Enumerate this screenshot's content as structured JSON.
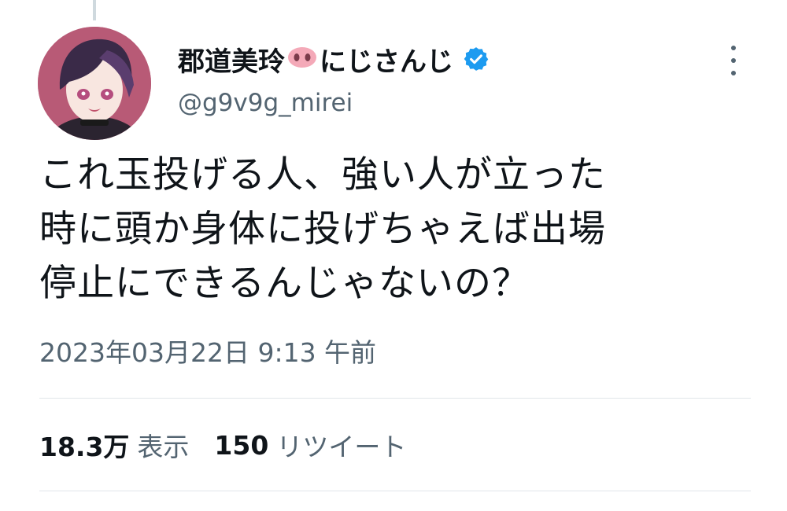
{
  "tweet": {
    "display_name": "郡道美玲",
    "name_emoji": "pig-nose-emoji",
    "name_suffix": "にじさんじ",
    "verified_icon": "verified-badge-icon",
    "handle": "@g9v9g_mirei",
    "more_icon": "more-options-icon",
    "text_lines": [
      "これ玉投げる人、強い人が立った",
      "時に頭か身体に投げちゃえば出場",
      "停止にできるんじゃないの？"
    ],
    "timestamp": "2023年03月22日 9:13 午前",
    "stats": {
      "views_count": "18.3万",
      "views_label": "表示",
      "retweets_count": "150",
      "retweets_label": "リツイート"
    }
  },
  "colors": {
    "text_primary": "#0f1419",
    "text_secondary": "#536471",
    "verified_blue": "#1d9bf0",
    "divider": "#e1e6ea",
    "emoji_pink": "#f4a9b8"
  }
}
